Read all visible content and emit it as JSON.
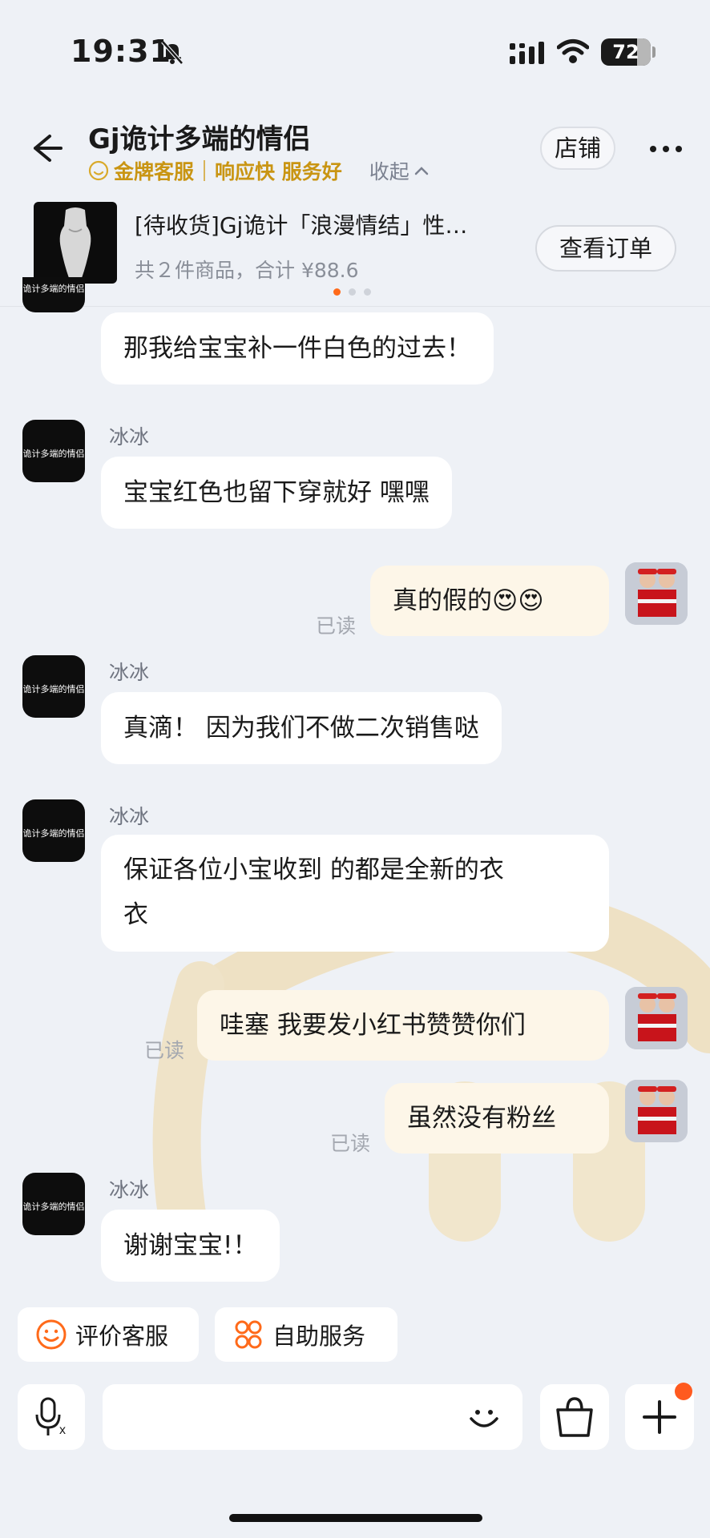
{
  "status_bar": {
    "time": "19:31",
    "battery": "72"
  },
  "header": {
    "back_icon": "arrow-left-icon",
    "shop_name": "Gj诡计多端的情侣",
    "badge_label": "金牌客服",
    "badge_slogan": "响应快 服务好",
    "collapse_label": "收起",
    "shop_button": "店铺",
    "more_icon": "more-dots-icon"
  },
  "order": {
    "title": "[待收货]Gj诡计「浪漫情结」性…",
    "summary": "共２件商品，合计 ¥88.6",
    "view_button": "查看订单",
    "pager_active": 0,
    "pager_count": 3
  },
  "messages": [
    {
      "from": "shop",
      "sender": "",
      "text": "那我给宝宝补一件白色的过去！"
    },
    {
      "from": "shop",
      "sender": "冰冰",
      "text": "宝宝红色也留下穿就好 嘿嘿"
    },
    {
      "from": "me",
      "text": "真的假的😍😍",
      "status": "已读"
    },
    {
      "from": "shop",
      "sender": "冰冰",
      "text": "真滴！ 因为我们不做二次销售哒"
    },
    {
      "from": "shop",
      "sender": "冰冰",
      "text_line1": "保证各位小宝收到 的都是全新的衣",
      "text_line2": "衣"
    },
    {
      "from": "me",
      "text": "哇塞 我要发小红书赞赞你们",
      "status": "已读"
    },
    {
      "from": "me",
      "text": "虽然没有粉丝",
      "status": "已读"
    },
    {
      "from": "shop",
      "sender": "冰冰",
      "text": "谢谢宝宝!！"
    }
  ],
  "avatar_caption": "诡计多端的情侣",
  "quick_actions": {
    "rate": "评价客服",
    "self_service": "自助服务"
  },
  "input_bar": {
    "voice_icon": "voice-input-icon",
    "emoji_icon": "emoji-icon",
    "bag_icon": "shopping-bag-icon",
    "plus_icon": "plus-icon"
  },
  "colors": {
    "accent_orange": "#ff6a1a",
    "gold": "#c99513",
    "me_bubble": "#fdf6e8",
    "background": "#eef1f6"
  }
}
